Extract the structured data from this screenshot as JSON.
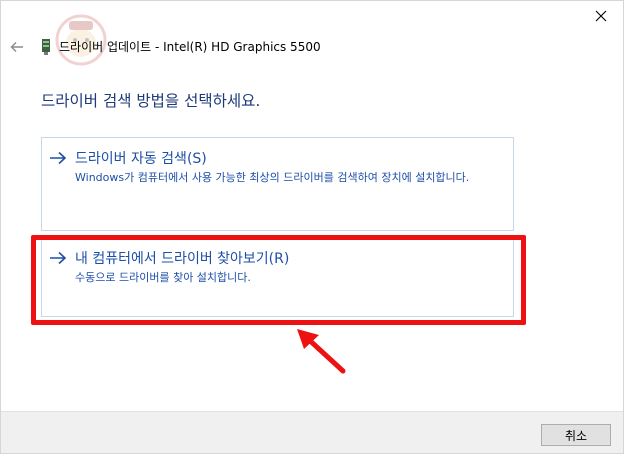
{
  "window": {
    "title": "드라이버 업데이트 - Intel(R) HD Graphics 5500",
    "close_icon": "close-icon",
    "back_icon": "back-arrow-icon",
    "device_icon": "display-adapter-icon"
  },
  "main": {
    "heading": "드라이버 검색 방법을 선택하세요.",
    "options": [
      {
        "title": "드라이버 자동 검색(S)",
        "description": "Windows가 컴퓨터에서 사용 가능한 최상의 드라이버를 검색하여 장치에 설치합니다.",
        "icon": "arrow-right-icon"
      },
      {
        "title": "내 컴퓨터에서 드라이버 찾아보기(R)",
        "description": "수동으로 드라이버를 찾아 설치합니다.",
        "icon": "arrow-right-icon"
      }
    ]
  },
  "annotation": {
    "highlight_color": "#ee1111",
    "pointer_icon": "red-pointer-arrow-icon"
  },
  "footer": {
    "cancel_label": "취소"
  },
  "colors": {
    "heading": "#1e3a78",
    "link": "#1e4fa8",
    "option_border": "#c8d8ea",
    "footer_bg": "#f0f0f0"
  }
}
